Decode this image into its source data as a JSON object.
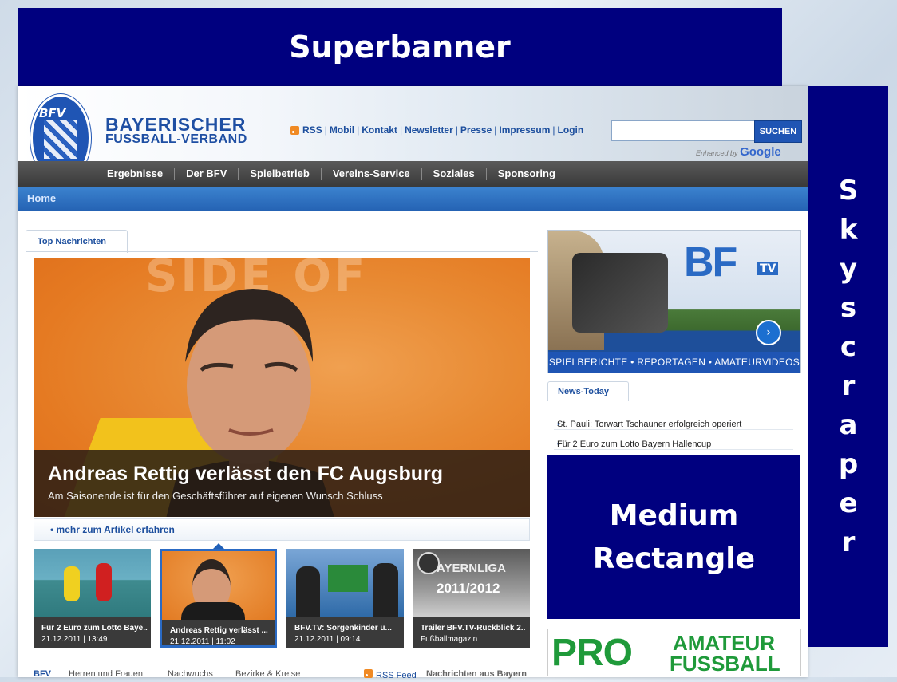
{
  "ads": {
    "superbanner": "Superbanner",
    "skyscraper": [
      "S",
      "k",
      "y",
      "s",
      "c",
      "r",
      "a",
      "p",
      "e",
      "r"
    ],
    "medium_rectangle": [
      "Medium",
      "Rectangle"
    ]
  },
  "header": {
    "logo_text": "BFV",
    "brand_line1": "BAYERISCHER",
    "brand_line2": "FUSSBALL-VERBAND",
    "links": [
      "RSS",
      "Mobil",
      "Kontakt",
      "Newsletter",
      "Presse",
      "Impressum",
      "Login"
    ],
    "search": {
      "placeholder": "",
      "button": "SUCHEN",
      "enhanced": "Enhanced by",
      "google": "Google"
    }
  },
  "nav": {
    "items": [
      "Ergebnisse",
      "Der BFV",
      "Spielbetrieb",
      "Vereins-Service",
      "Soziales",
      "Sponsoring"
    ]
  },
  "breadcrumb": {
    "home": "Home"
  },
  "top_news": {
    "tab": "Top Nachrichten",
    "hero_bg_text": "SIDE OF",
    "hero_title": "Andreas Rettig verlässt den FC Augsburg",
    "hero_subtitle": "Am Saisonende ist für den Geschäftsführer auf eigenen Wunsch Schluss",
    "more_link": "• mehr zum Artikel erfahren",
    "thumbs": [
      {
        "title": "Für 2 Euro zum Lotto Baye..",
        "date": "21.12.2011 | 13:49"
      },
      {
        "title": "Andreas Rettig verlässt ...",
        "date": "21.12.2011 | 11:02"
      },
      {
        "title": "BFV.TV: Sorgenkinder u...",
        "date": "21.12.2011 | 09:14"
      },
      {
        "title": "Trailer BFV.TV-Rückblick 2..",
        "date": "Fußballmagazin"
      }
    ],
    "thumb3_overlay": "AYERNLIGA",
    "thumb3_season": "2011/2012"
  },
  "bottom_tabs": [
    "BFV",
    "Herren und Frauen",
    "Nachwuchs",
    "Bezirke & Kreise",
    "RSS Feed",
    "Nachrichten aus Bayern"
  ],
  "bfvtv": {
    "logo": "BF",
    "tv": "TV",
    "strip": "SPIELBERICHTE • REPORTAGEN • AMATEURVIDEOS"
  },
  "news_today": {
    "tab": "News-Today",
    "items": [
      "St. Pauli: Torwart Tschauner erfolgreich operiert",
      "Für 2 Euro zum Lotto Bayern Hallencup"
    ]
  },
  "pro_amateur": {
    "pro": "PRO",
    "line1": "AMATEUR",
    "line2": "FUSSBALL"
  },
  "colors": {
    "ad_blue": "#00007f",
    "brand_blue": "#1f4fa3",
    "nav_dark": "#444444",
    "crumb_blue": "#2d6fc2"
  }
}
